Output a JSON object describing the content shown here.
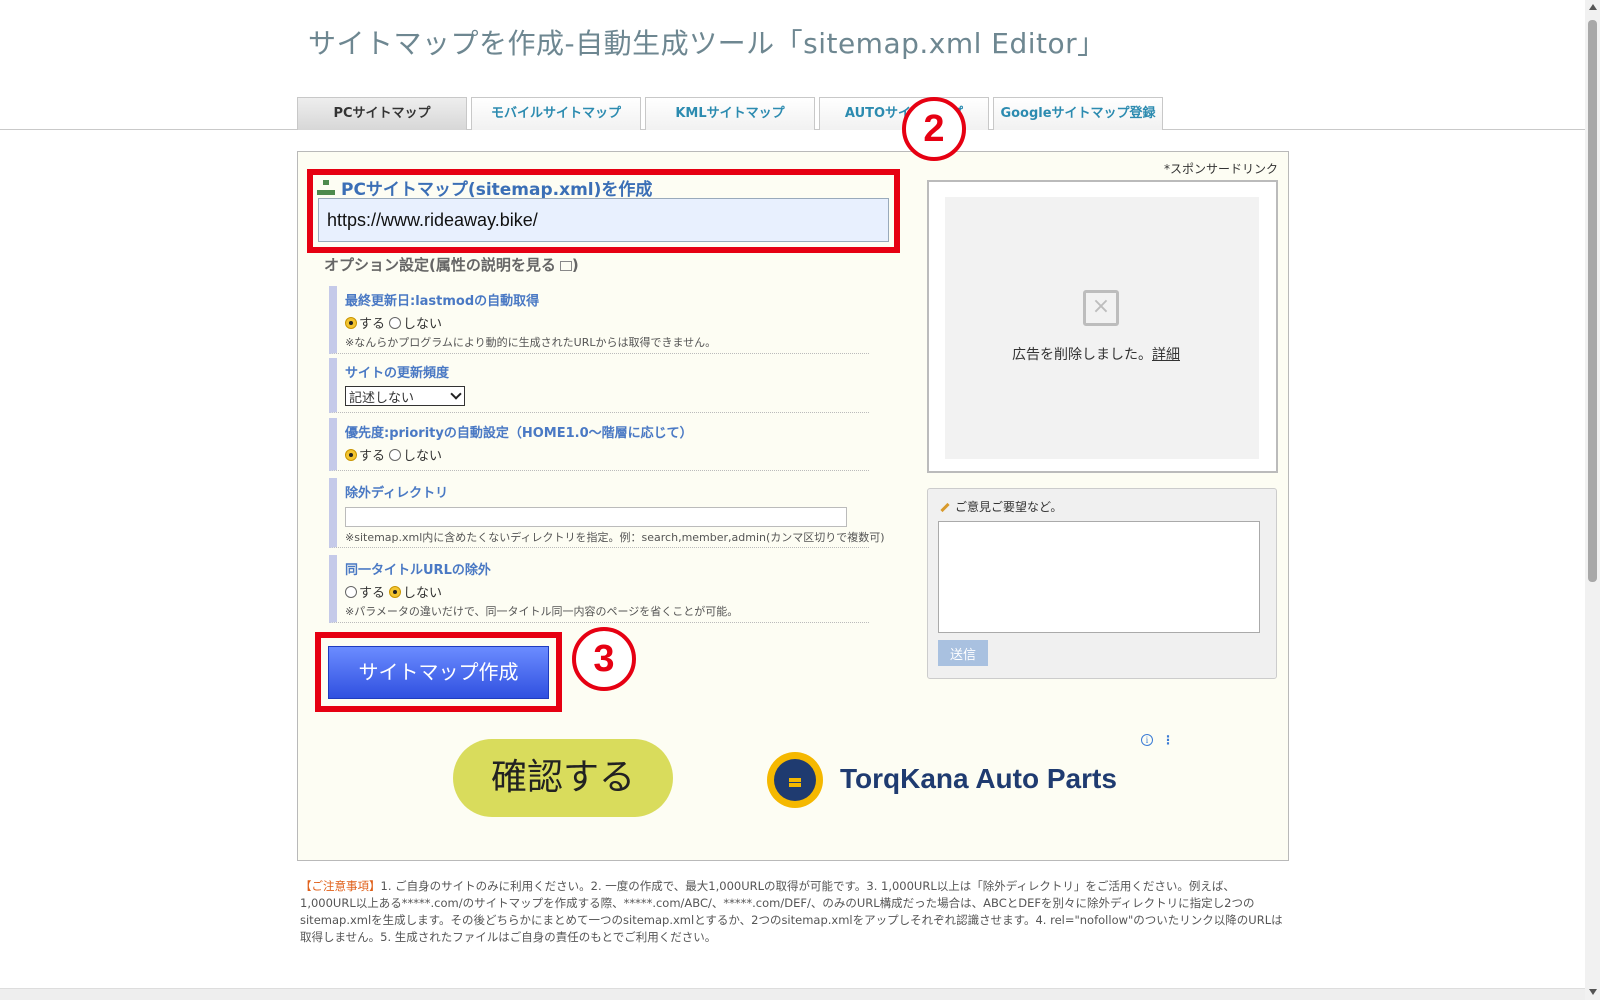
{
  "page": {
    "title": "サイトマップを作成-自動生成ツール「sitemap.xml Editor」"
  },
  "tabs": [
    {
      "label": "PCサイトマップ"
    },
    {
      "label": "モバイルサイトマップ"
    },
    {
      "label": "KMLサイトマップ"
    },
    {
      "label": "AUTOサイトマップ"
    },
    {
      "label": "Googleサイトマップ登録"
    }
  ],
  "form": {
    "title": "PCサイトマップ(sitemap.xml)を作成",
    "url_value": "https://www.rideaway.bike/",
    "options_heading": "オプション設定(属性の説明を見る",
    "options_heading_close": ")",
    "lastmod": {
      "label": "最終更新日:lastmodの自動取得",
      "yes": "する",
      "no": "しない",
      "selected": "yes",
      "note": "※なんらかプログラムにより動的に生成されたURLからは取得できません。"
    },
    "changefreq": {
      "label": "サイトの更新頻度",
      "value": "記述しない"
    },
    "priority": {
      "label": "優先度:priorityの自動設定（HOME1.0～階層に応じて）",
      "yes": "する",
      "no": "しない",
      "selected": "yes"
    },
    "exclude": {
      "label": "除外ディレクトリ",
      "note": "※sitemap.xml内に含めたくないディレクトリを指定。例：search,member,admin(カンマ区切りで複数可)"
    },
    "same_title": {
      "label": "同一タイトルURLの除外",
      "yes": "する",
      "no": "しない",
      "selected": "no",
      "note": "※パラメータの違いだけで、同一タイトル同一内容のページを省くことが可能。"
    },
    "create_button": "サイトマップ作成"
  },
  "annotations": {
    "two": "2",
    "three": "3"
  },
  "sidebar": {
    "sponsor_label": "*スポンサードリンク",
    "ad_removed": "広告を削除しました。",
    "ad_detail": "詳細",
    "feedback_label": "ご意見ご要望など。",
    "send_button": "送信"
  },
  "ad_banner": {
    "confirm": "確認する",
    "brand": "TorqKana Auto Parts",
    "info": "i",
    "more": "⋮"
  },
  "notice": {
    "lead": "【ご注意事項】",
    "text": "1. ご自身のサイトのみに利用ください。2. 一度の作成で、最大1,000URLの取得が可能です。3. 1,000URL以上は「除外ディレクトリ」をご活用ください。例えば、1,000URL以上ある*****.com/のサイトマップを作成する際、*****.com/ABC/、*****.com/DEF/、のみのURL構成だった場合は、ABCとDEFを別々に除外ディレクトリに指定し2つのsitemap.xmlを生成します。その後どちらかにまとめて一つのsitemap.xmlとするか、2つのsitemap.xmlをアップしそれぞれ認識させます。4. rel=\"nofollow\"のついたリンク以降のURLは取得しません。5. 生成されたファイルはご自身の責任のもとでご利用ください。"
  },
  "colors": {
    "highlight_red": "#e60012",
    "link_blue": "#3b6fb6",
    "button_blue": "#3050e0",
    "confirm_yellow": "#d9dc5c",
    "brand_navy": "#1f3b70",
    "brand_gold": "#f5b800"
  }
}
